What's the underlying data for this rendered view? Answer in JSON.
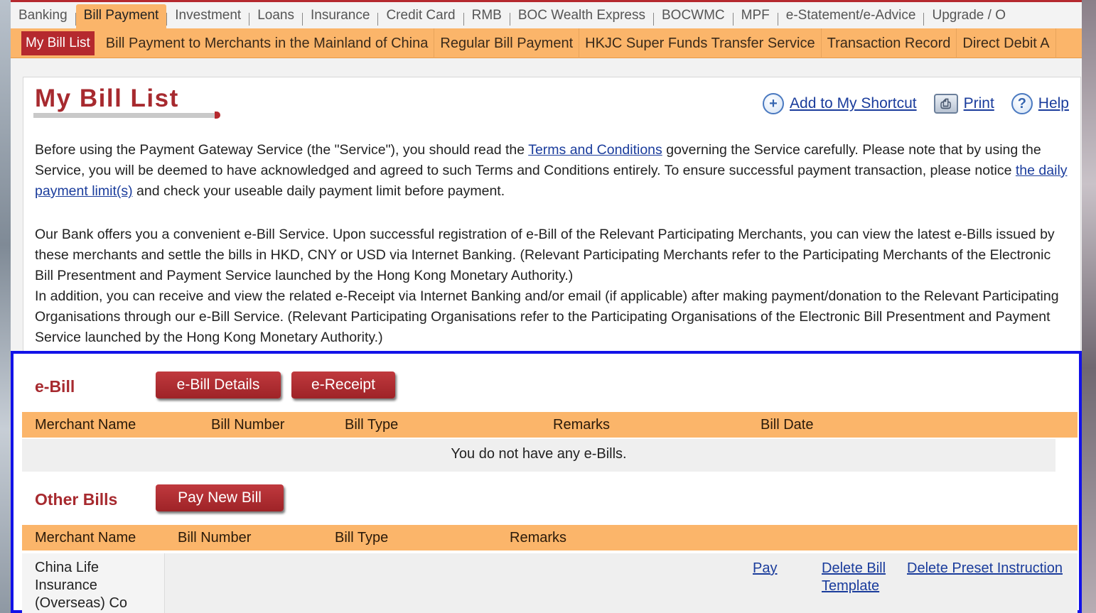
{
  "top_nav": [
    "Banking",
    "Bill Payment",
    "Investment",
    "Loans",
    "Insurance",
    "Credit Card",
    "RMB",
    "BOC Wealth Express",
    "BOCWMC",
    "MPF",
    "e-Statement/e-Advice",
    "Upgrade / O"
  ],
  "top_nav_active": "Bill Payment",
  "sub_nav": [
    "My Bill List",
    "Bill Payment to Merchants in the Mainland of China",
    "Regular Bill Payment",
    "HKJC Super Funds Transfer Service",
    "Transaction Record",
    "Direct Debit A"
  ],
  "page": {
    "title": "My Bill List",
    "tools": {
      "shortcut": "Add to My Shortcut",
      "print": "Print",
      "help": "Help"
    },
    "para1": {
      "before_link1": "Before using the Payment Gateway Service (the \"Service\"), you should read the ",
      "link1": "Terms and Conditions",
      "after_link1": " governing the Service carefully. Please note that by using the Service, you will be deemed to have acknowledged and agreed to such Terms and Conditions entirely. To ensure successful payment transaction, please notice ",
      "link2": "the daily payment limit(s)",
      "after_link2": " and check your useable daily payment limit before payment."
    },
    "para2": "Our Bank offers you a convenient e-Bill Service. Upon successful registration of e-Bill of the Relevant Participating Merchants, you can view the latest e-Bills issued by these merchants and settle the bills in HKD, CNY or USD via Internet Banking. (Relevant Participating Merchants refer to the Participating Merchants of the Electronic Bill Presentment and Payment Service launched by the Hong Kong Monetary Authority.)",
    "para3": "In addition, you can receive and view the related e-Receipt via Internet Banking and/or email (if applicable) after making payment/donation to the Relevant Participating Organisations through our e-Bill Service. (Relevant Participating Organisations refer to the Participating Organisations of the Electronic Bill Presentment and Payment Service launched by the Hong Kong Monetary Authority.)"
  },
  "ebill": {
    "title": "e-Bill",
    "details_btn": "e-Bill Details",
    "receipt_btn": "e-Receipt",
    "columns": [
      "Merchant Name",
      "Bill Number",
      "Bill Type",
      "Remarks",
      "Bill Date"
    ],
    "empty_text": "You do not have any e-Bills."
  },
  "other_bills": {
    "title": "Other Bills",
    "pay_btn": "Pay New Bill",
    "columns": [
      "Merchant Name",
      "Bill Number",
      "Bill Type",
      "Remarks"
    ],
    "rows": [
      {
        "merchant": "China Life Insurance (Overseas) Co",
        "pay": "Pay",
        "delete_template": "Delete Bill Template",
        "delete_preset": "Delete Preset Instruction"
      }
    ]
  },
  "colors": {
    "brand_red": "#b5292e",
    "nav_orange": "#fbb56a",
    "link_blue": "#1a3c9c",
    "highlight_blue": "#1212e8"
  }
}
